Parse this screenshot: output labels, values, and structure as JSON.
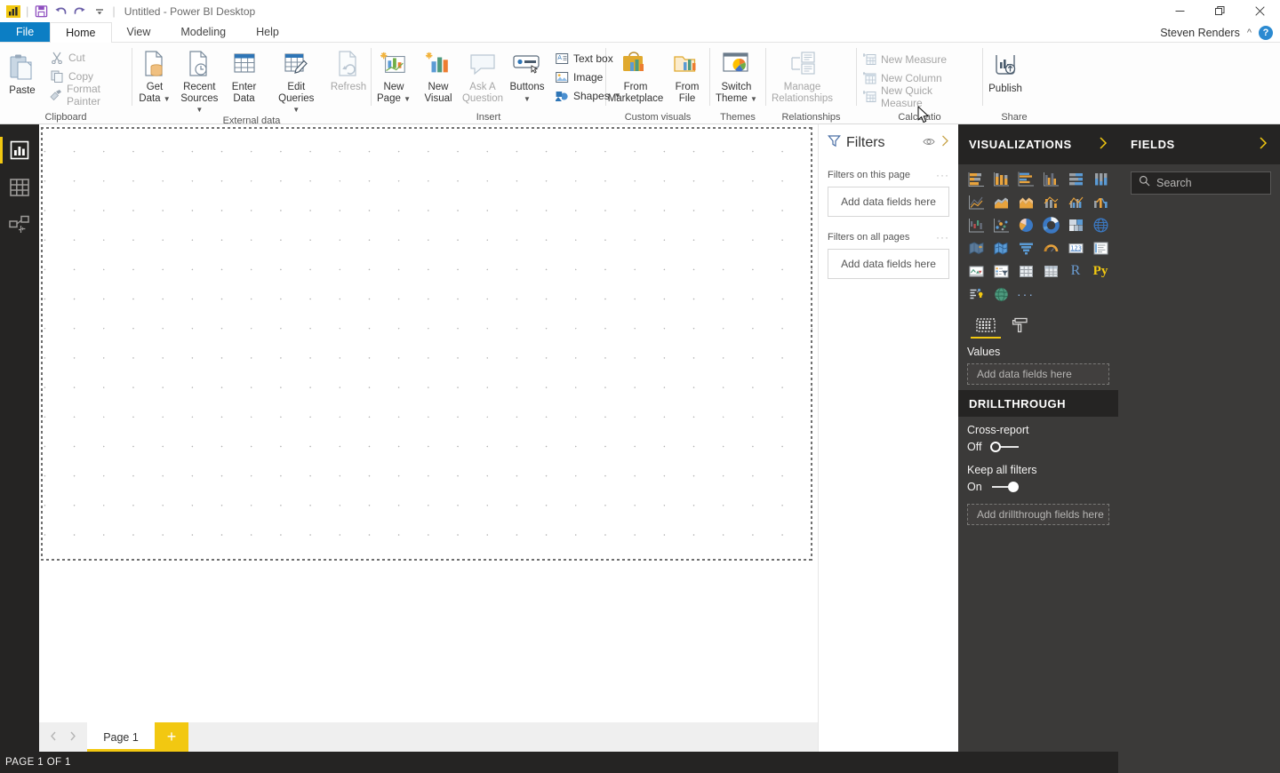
{
  "titlebar": {
    "document_title": "Untitled - Power BI Desktop",
    "quick_access": [
      {
        "name": "powerbi-logo-icon",
        "label": "Power BI"
      },
      {
        "name": "save-icon",
        "label": "Save"
      },
      {
        "name": "undo-icon",
        "label": "Undo"
      },
      {
        "name": "redo-icon",
        "label": "Redo"
      },
      {
        "name": "customize-quick-access-icon",
        "label": "Customize Quick Access Toolbar"
      }
    ],
    "window_controls": [
      {
        "name": "minimize-button",
        "glyph": "─"
      },
      {
        "name": "restore-button",
        "glyph": "❐"
      },
      {
        "name": "close-button",
        "glyph": "✕"
      }
    ]
  },
  "ribbon_tabs": {
    "file": "File",
    "tabs": [
      "Home",
      "View",
      "Modeling",
      "Help"
    ],
    "active": "Home",
    "username": "Steven Renders",
    "collapse_icon": "chevron-up-icon",
    "help_label": "?"
  },
  "ribbon": {
    "groups": [
      {
        "label": "Clipboard",
        "big": [
          {
            "label": "Paste",
            "icon": "paste-icon",
            "disabled": false
          }
        ],
        "small": [
          {
            "label": "Cut",
            "icon": "cut-icon",
            "disabled": true
          },
          {
            "label": "Copy",
            "icon": "copy-icon",
            "disabled": true
          },
          {
            "label": "Format Painter",
            "icon": "format-painter-icon",
            "disabled": true
          }
        ]
      },
      {
        "label": "External data",
        "big": [
          {
            "label": "Get\nData",
            "l1": "Get",
            "l2": "Data",
            "icon": "get-data-icon",
            "caret": true
          },
          {
            "label": "Recent\nSources",
            "l1": "Recent",
            "l2": "Sources",
            "icon": "recent-sources-icon",
            "caret": true
          },
          {
            "label": "Enter\nData",
            "l1": "Enter",
            "l2": "Data",
            "icon": "enter-data-icon",
            "caret": false
          },
          {
            "label": "Edit\nQueries",
            "l1": "Edit",
            "l2": "Queries",
            "icon": "edit-queries-icon",
            "caret": true
          },
          {
            "label": "Refresh",
            "l1": "Refresh",
            "l2": "",
            "icon": "refresh-icon",
            "caret": false,
            "disabled": true
          }
        ]
      },
      {
        "label": "Insert",
        "big": [
          {
            "label": "New Page",
            "l1": "New",
            "l2": "Page",
            "icon": "new-page-icon",
            "caret": true
          },
          {
            "label": "New Visual",
            "l1": "New",
            "l2": "Visual",
            "icon": "new-visual-icon",
            "caret": false
          },
          {
            "label": "Ask A Question",
            "l1": "Ask A",
            "l2": "Question",
            "icon": "ask-a-question-icon",
            "caret": false,
            "disabled": true
          },
          {
            "label": "Buttons",
            "l1": "Buttons",
            "l2": "",
            "icon": "buttons-icon",
            "caret": true
          }
        ],
        "small": [
          {
            "label": "Text box",
            "icon": "text-box-icon"
          },
          {
            "label": "Image",
            "icon": "image-icon"
          },
          {
            "label": "Shapes",
            "icon": "shapes-icon",
            "caret": true
          }
        ]
      },
      {
        "label": "Custom visuals",
        "big": [
          {
            "label": "From Marketplace",
            "l1": "From",
            "l2": "Marketplace",
            "icon": "from-marketplace-icon",
            "caret": false
          },
          {
            "label": "From File",
            "l1": "From",
            "l2": "File",
            "icon": "from-file-icon",
            "caret": false
          }
        ]
      },
      {
        "label": "Themes",
        "big": [
          {
            "label": "Switch Theme",
            "l1": "Switch",
            "l2": "Theme",
            "icon": "switch-theme-icon",
            "caret": true
          }
        ]
      },
      {
        "label": "Relationships",
        "big": [
          {
            "label": "Manage Relationships",
            "l1": "Manage",
            "l2": "Relationships",
            "icon": "manage-relationships-icon",
            "caret": false,
            "disabled": true
          }
        ]
      },
      {
        "label": "Calculatio",
        "small": [
          {
            "label": "New Measure",
            "icon": "new-measure-icon",
            "disabled": true
          },
          {
            "label": "New Column",
            "icon": "new-column-icon",
            "disabled": true
          },
          {
            "label": "New Quick Measure",
            "icon": "new-quick-measure-icon",
            "disabled": true
          }
        ]
      },
      {
        "label": "Share",
        "big": [
          {
            "label": "Publish",
            "l1": "Publish",
            "l2": "",
            "icon": "publish-icon",
            "caret": false
          }
        ]
      }
    ]
  },
  "view_switcher": {
    "items": [
      {
        "name": "report-view",
        "icon": "report-bar-chart-icon",
        "active": true
      },
      {
        "name": "data-view",
        "icon": "data-table-icon",
        "active": false
      },
      {
        "name": "model-view",
        "icon": "model-relationships-icon",
        "active": false
      }
    ]
  },
  "filters_panel": {
    "title": "Filters",
    "filter_icon": "funnel-icon",
    "eye_icon": "eye-icon",
    "expand_icon": "chevron-right-icon",
    "sections": [
      {
        "label": "Filters on this page",
        "dropzone": "Add data fields here",
        "menu": "···"
      },
      {
        "label": "Filters on all pages",
        "dropzone": "Add data fields here",
        "menu": "···"
      }
    ]
  },
  "visualizations_panel": {
    "title": "VISUALIZATIONS",
    "expand_icon": "chevron-right-icon",
    "icons": [
      {
        "name": "stacked-bar-chart-icon"
      },
      {
        "name": "stacked-column-chart-icon"
      },
      {
        "name": "clustered-bar-chart-icon"
      },
      {
        "name": "clustered-column-chart-icon"
      },
      {
        "name": "100-percent-stacked-bar-chart-icon"
      },
      {
        "name": "100-percent-stacked-column-chart-icon"
      },
      {
        "name": "line-chart-icon"
      },
      {
        "name": "area-chart-icon"
      },
      {
        "name": "stacked-area-chart-icon"
      },
      {
        "name": "line-stacked-column-chart-icon"
      },
      {
        "name": "line-clustered-column-chart-icon"
      },
      {
        "name": "ribbon-chart-icon"
      },
      {
        "name": "waterfall-chart-icon"
      },
      {
        "name": "scatter-chart-icon"
      },
      {
        "name": "pie-chart-icon"
      },
      {
        "name": "donut-chart-icon"
      },
      {
        "name": "treemap-icon"
      },
      {
        "name": "map-icon"
      },
      {
        "name": "filled-map-icon"
      },
      {
        "name": "shape-map-icon"
      },
      {
        "name": "funnel-chart-icon"
      },
      {
        "name": "gauge-icon"
      },
      {
        "name": "card-icon"
      },
      {
        "name": "multi-row-card-icon"
      },
      {
        "name": "kpi-icon"
      },
      {
        "name": "slicer-icon"
      },
      {
        "name": "table-icon"
      },
      {
        "name": "matrix-icon"
      },
      {
        "name": "r-script-visual-icon",
        "text": "R"
      },
      {
        "name": "python-visual-icon",
        "text": "Py"
      },
      {
        "name": "key-influencers-icon"
      },
      {
        "name": "arcgis-maps-icon"
      },
      {
        "name": "more-options-icon",
        "text": "···"
      }
    ],
    "field_tabs": [
      {
        "name": "fields-tab",
        "icon": "fields-grid-icon",
        "active": true
      },
      {
        "name": "format-tab",
        "icon": "paint-roller-icon",
        "active": false
      }
    ],
    "values_well": {
      "title": "Values",
      "dropzone": "Add data fields here"
    },
    "drillthrough": {
      "title": "DRILLTHROUGH",
      "cross_report": {
        "label": "Cross-report",
        "state": "Off",
        "on": false
      },
      "keep_all_filters": {
        "label": "Keep all filters",
        "state": "On",
        "on": true
      },
      "dropzone": "Add drillthrough fields here"
    }
  },
  "fields_panel": {
    "title": "FIELDS",
    "expand_icon": "chevron-right-icon",
    "search": {
      "placeholder": "Search",
      "value": "",
      "icon": "search-icon"
    }
  },
  "page_bar": {
    "prev_icon": "chevron-left-icon",
    "next_icon": "chevron-right-icon",
    "tabs": [
      {
        "label": "Page 1",
        "active": true
      }
    ],
    "add_label": "+"
  },
  "status_bar": {
    "text": "PAGE 1 OF 1"
  },
  "colors": {
    "accent_yellow": "#f2c811",
    "file_tab_blue": "#0c7ec4",
    "panel_dark": "#3b3a39",
    "panel_darker": "#252423"
  }
}
